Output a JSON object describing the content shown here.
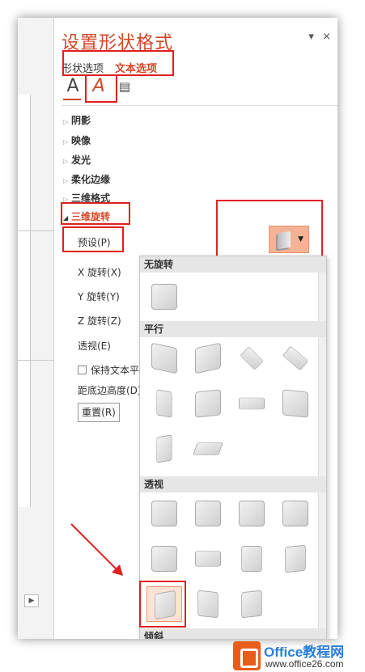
{
  "pane": {
    "title": "设置形状格式",
    "controls": {
      "pin": "▾",
      "close": "×"
    },
    "tabs": [
      {
        "label": "形状选项"
      },
      {
        "label": "文本选项"
      }
    ],
    "icons": [
      "text-fill-icon",
      "text-effects-icon",
      "text-box-icon"
    ]
  },
  "sections": [
    {
      "label": "阴影"
    },
    {
      "label": "映像"
    },
    {
      "label": "发光"
    },
    {
      "label": "柔化边缘"
    },
    {
      "label": "三维格式"
    },
    {
      "label": "三维旋转"
    }
  ],
  "rotation": {
    "preset_label": "预设(P)",
    "x_label": "X 旋转(X)",
    "y_label": "Y 旋转(Y)",
    "z_label": "Z 旋转(Z)",
    "perspective_label": "透视(E)",
    "keep_flat_label": "保持文本平",
    "distance_label": "距底边高度(D)",
    "reset_label": "重置(R)"
  },
  "gallery": {
    "groups": [
      {
        "label": "无旋转"
      },
      {
        "label": "平行"
      },
      {
        "label": "透视"
      },
      {
        "label": "倾斜"
      }
    ]
  },
  "watermark": {
    "brand": "Office教程网",
    "url": "www.office26.com"
  },
  "colors": {
    "accent": "#d24726",
    "highlight": "#e02020",
    "selected": "#f4b394"
  }
}
